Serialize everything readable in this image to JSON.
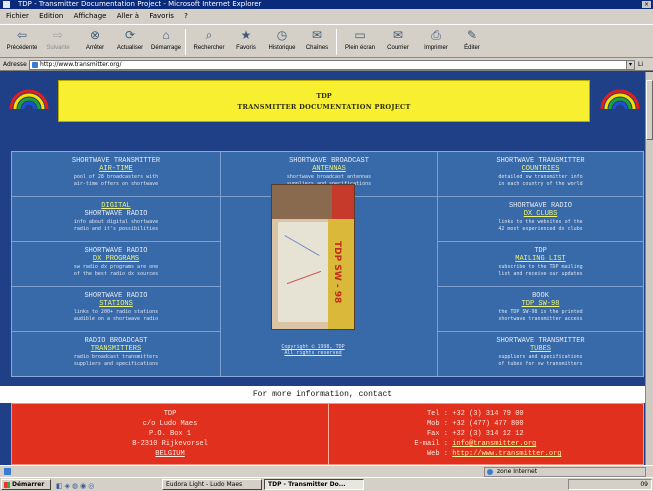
{
  "window": {
    "title": "TDP - Transmitter Documentation Project - Microsoft Internet Explorer",
    "close": "×"
  },
  "menu": [
    "Fichier",
    "Edition",
    "Affichage",
    "Aller à",
    "Favoris",
    "?"
  ],
  "toolbar": [
    {
      "icon": "back-arrow-icon",
      "glyph": "⇦",
      "label": "Précédente",
      "enabled": true
    },
    {
      "icon": "forward-arrow-icon",
      "glyph": "⇨",
      "label": "Suivante",
      "enabled": false
    },
    {
      "icon": "stop-icon",
      "glyph": "⊗",
      "label": "Arrêter",
      "enabled": true
    },
    {
      "icon": "refresh-icon",
      "glyph": "⟳",
      "label": "Actualiser",
      "enabled": true
    },
    {
      "icon": "home-icon",
      "glyph": "⌂",
      "label": "Démarrage",
      "enabled": true
    },
    {
      "icon": "search-icon",
      "glyph": "⌕",
      "label": "Rechercher",
      "enabled": true
    },
    {
      "icon": "favorites-icon",
      "glyph": "★",
      "label": "Favoris",
      "enabled": true
    },
    {
      "icon": "history-icon",
      "glyph": "◷",
      "label": "Historique",
      "enabled": true
    },
    {
      "icon": "channels-icon",
      "glyph": "✉",
      "label": "Chaînes",
      "enabled": true
    },
    {
      "icon": "fullscreen-icon",
      "glyph": "▭",
      "label": "Plein écran",
      "enabled": true
    },
    {
      "icon": "mail-icon",
      "glyph": "✉",
      "label": "Courrier",
      "enabled": true
    },
    {
      "icon": "print-icon",
      "glyph": "⎙",
      "label": "Imprimer",
      "enabled": true
    },
    {
      "icon": "edit-icon",
      "glyph": "✎",
      "label": "Éditer",
      "enabled": true
    }
  ],
  "address": {
    "label": "Adresse",
    "url": "http://www.transmitter.org/",
    "links": "Li"
  },
  "header": {
    "acronym": "TDP",
    "full": "TRANSMITTER DOCUMENTATION PROJECT"
  },
  "cells": {
    "aim": {
      "t1": "SHORTWAVE TRANSMITTER",
      "t2": "AIR-TIME",
      "d1": "pool of 28 broadcasters with",
      "d2": "air-time offers on shortwave"
    },
    "antennas": {
      "t1": "SHORTWAVE BROADCAST",
      "t2": "ANTENNAS",
      "d1": "shortwave broadcast antennas",
      "d2": "suppliers and specifications"
    },
    "countries": {
      "t1": "SHORTWAVE TRANSMITTER",
      "t2": "COUNTRIES",
      "d1": "detailed sw transmitter info",
      "d2": "in each country of the world"
    },
    "digital": {
      "t1": "DIGITAL",
      "t2": "SHORTWAVE RADIO",
      "d1": "info about digital shortwave",
      "d2": "radio and it's possibilities"
    },
    "dxclubs": {
      "t1": "SHORTWAVE RADIO",
      "t2": "DX CLUBS",
      "d1": "links to the websites of the",
      "d2": "42 most experienced dx clubs"
    },
    "dxprog": {
      "t1": "SHORTWAVE RADIO",
      "t2": "DX PROGRAMS",
      "d1": "sw radio dx programs are one",
      "d2": "of the best radio dx sources"
    },
    "mailing": {
      "t1": "TDP",
      "t2": "MAILING LIST",
      "d1": "subscribe to the TDP mailing",
      "d2": "list and receive our updates"
    },
    "stations": {
      "t1": "SHORTWAVE RADIO",
      "t2": "STATIONS",
      "d1": "links to 200+ radio stations",
      "d2": "audible on a shortwave radio"
    },
    "book": {
      "t1": "BOOK",
      "t2": "TDP SW-98",
      "d1": "the TDP SW-98 is the printed",
      "d2": "shortwave transmitter access"
    },
    "radio": {
      "t1": "RADIO BROADCAST",
      "t2": "TRANSMITTERS",
      "d1": "radio broadcast transmitters",
      "d2": "suppliers and specifications"
    },
    "tubes": {
      "t1": "SHORTWAVE TRANSMITTER",
      "t2": "TUBES",
      "d1": "suppliers and specifications",
      "d2": "of tubes for sw transmitters"
    }
  },
  "book_cover": {
    "spine": "TDP SW - 98"
  },
  "copyright": {
    "line1": "Copyright © 1998, TDP",
    "line2": "All rights reserved"
  },
  "more_info": "For more information, contact",
  "address_block": [
    "TDP",
    "c/o Ludo Maes",
    "P.O. Box 1",
    "B-2310 Rijkevorsel",
    "BELGIUM"
  ],
  "contact_lines": [
    {
      "k": "Tel :",
      "v": "+32 (3) 314 79 00",
      "link": false
    },
    {
      "k": "Mob :",
      "v": "+32 (477) 477 800",
      "link": false
    },
    {
      "k": "Fax :",
      "v": "+32 (3) 314 12 12",
      "link": false
    },
    {
      "k": "E-mail :",
      "v": "info@transmitter.org",
      "link": true
    },
    {
      "k": "Web :",
      "v": "http://www.transmitter.org",
      "link": true
    }
  ],
  "status": {
    "zone": "zone Internet"
  },
  "taskbar": {
    "start": "Démarrer",
    "tasks": [
      "Eudora Light - Ludo Maes",
      "TDP - Transmitter Do..."
    ],
    "tray": "09"
  },
  "colors": {
    "page_bg": "#1f3f86",
    "grid_bg": "#3869a8",
    "header_bg": "#f7ef2f",
    "contact_bg": "#e2301e",
    "link_yellow": "#ecf27a"
  }
}
